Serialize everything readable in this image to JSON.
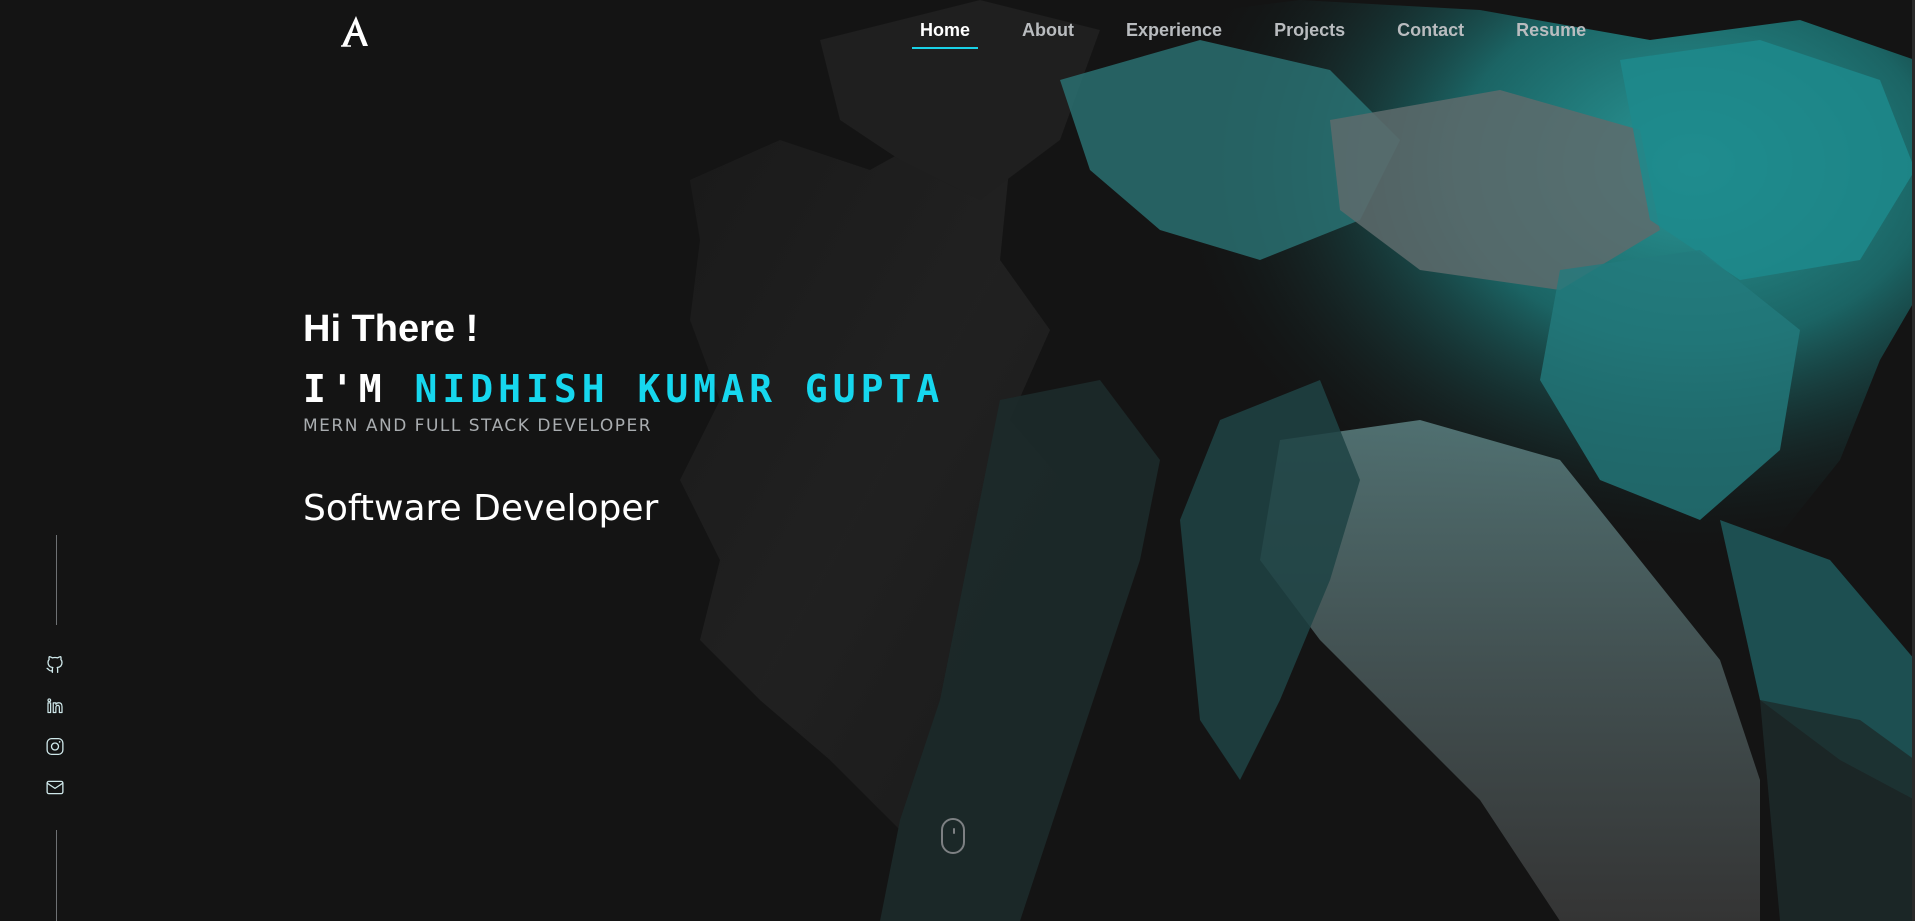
{
  "colors": {
    "background": "#141414",
    "accent": "#16d7ee",
    "nav_text": "#b9bcbf",
    "nav_active": "#ffffff",
    "muted_text": "#a9adb0"
  },
  "header": {
    "logo_icon": "a-monogram-logo",
    "nav": [
      {
        "label": "Home",
        "active": true
      },
      {
        "label": "About",
        "active": false
      },
      {
        "label": "Experience",
        "active": false
      },
      {
        "label": "Projects",
        "active": false
      },
      {
        "label": "Contact",
        "active": false
      },
      {
        "label": "Resume",
        "active": false
      }
    ]
  },
  "hero": {
    "greeting": "Hi There !",
    "name_prefix": "I'M",
    "name": "NIDHISH KUMAR GUPTA",
    "tagline": "MERN AND FULL STACK DEVELOPER",
    "role": "Software Developer"
  },
  "social": {
    "icons": [
      "github-icon",
      "linkedin-icon",
      "instagram-icon",
      "mail-icon"
    ]
  },
  "scroll_indicator": {
    "icon": "mouse-scroll-icon"
  }
}
